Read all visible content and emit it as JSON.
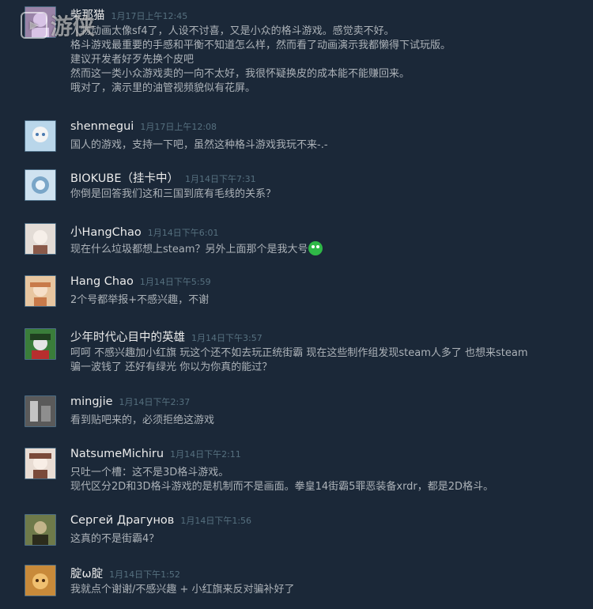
{
  "watermark": "游侠",
  "comments": [
    {
      "author": "柴那猫",
      "timestamp": "1月17日上午12:45",
      "lines": [
        "人物动画太像sf4了，人设不讨喜，又是小众的格斗游戏。感觉卖不好。",
        "格斗游戏最重要的手感和平衡不知道怎么样，然而看了动画演示我都懒得下试玩版。",
        "建议开发者好歹先换个皮吧",
        "然而这一类小众游戏卖的一向不太好，我很怀疑换皮的成本能不能赚回来。",
        "哦对了，演示里的油管视频貌似有花屏。"
      ],
      "avatar": {
        "bg": "#9a84a8",
        "fg": "#d8c3e6"
      }
    },
    {
      "author": "shenmegui",
      "timestamp": "1月17日上午12:08",
      "lines": [
        "国人的游戏，支持一下吧，虽然这种格斗游戏我玩不来-.-"
      ],
      "avatar": {
        "bg": "#b9d6ea",
        "fg": "#f4f4f4"
      }
    },
    {
      "author": "BIOKUBE（挂卡中）",
      "timestamp": "1月14日下午7:31",
      "lines": [
        "你倒是回答我们这和三国到底有毛线的关系？"
      ],
      "avatar": {
        "bg": "#cfe2f0",
        "fg": "#7aa6c8"
      }
    },
    {
      "author": "小HangChao",
      "timestamp": "1月14日下午6:01",
      "lines": [
        "现在什么垃圾都想上steam？另外上面那个是我大号"
      ],
      "emote": "green-face-emoticon",
      "avatar": {
        "bg": "#e3dcd6",
        "fg": "#8a5a4a"
      }
    },
    {
      "author": "Hang Chao",
      "timestamp": "1月14日下午5:59",
      "lines": [
        "2个号都举报+不感兴趣，不谢"
      ],
      "avatar": {
        "bg": "#e8c6a0",
        "fg": "#c87a4a"
      }
    },
    {
      "author": "少年时代心目中的英雄",
      "timestamp": "1月14日下午3:57",
      "lines": [
        "呵呵 不感兴趣加小红旗 玩这个还不如去玩正统街霸 现在这些制作组发现steam人多了 也想来steam",
        "骗一波钱了 还好有绿光 你以为你真的能过？"
      ],
      "avatar": {
        "bg": "#3a7d3a",
        "fg": "#e6e6e6"
      }
    },
    {
      "author": "mingjie",
      "timestamp": "1月14日下午2:37",
      "lines": [
        "看到贴吧来的，必须拒绝这游戏"
      ],
      "avatar": {
        "bg": "#5a5a5a",
        "fg": "#c4c4c4"
      }
    },
    {
      "author": "NatsumeMichiru",
      "timestamp": "1月14日下午2:11",
      "lines": [
        "只吐一个槽：这不是3D格斗游戏。",
        "现代区分2D和3D格斗游戏的是机制而不是画面。拳皇14街霸5罪恶装备xrdr，都是2D格斗。"
      ],
      "avatar": {
        "bg": "#e9ddd4",
        "fg": "#7a4a3a"
      }
    },
    {
      "author": "Сергей Драгунов",
      "timestamp": "1月14日下午1:56",
      "lines": [
        "这真的不是街霸4？"
      ],
      "avatar": {
        "bg": "#6e7a4a",
        "fg": "#2c2c1c"
      }
    },
    {
      "author": "腚ω腚",
      "timestamp": "1月14日下午1:52",
      "lines": [
        "我就点个谢谢/不感兴趣 + 小红旗来反对骗补好了"
      ],
      "avatar": {
        "bg": "#c88a3a",
        "fg": "#f0c070"
      }
    }
  ]
}
